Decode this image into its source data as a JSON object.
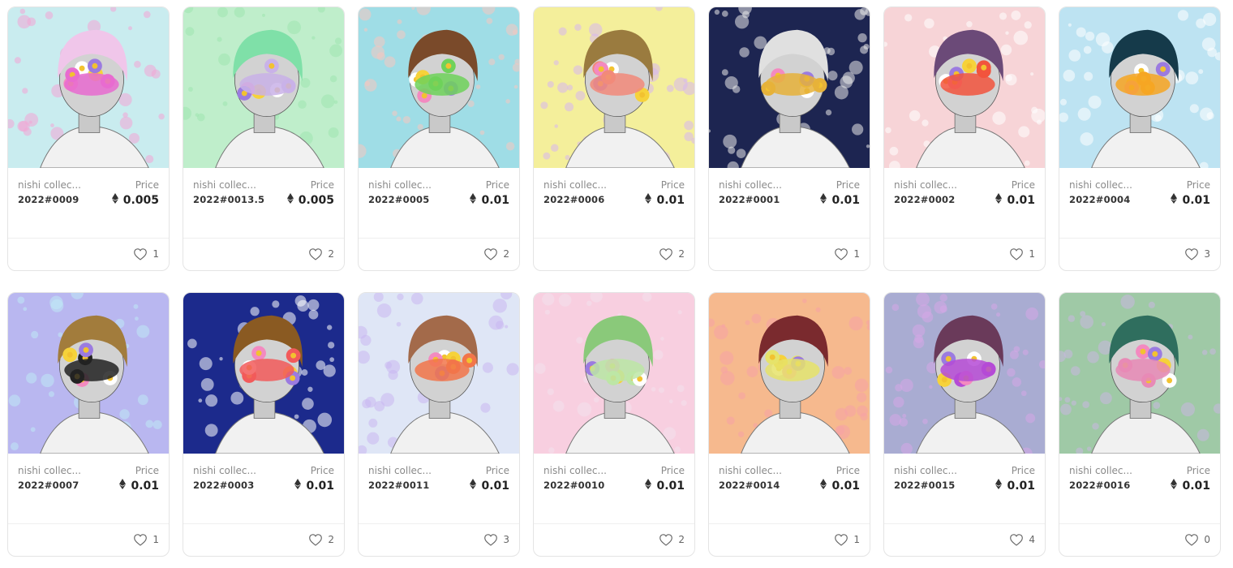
{
  "price_label": "Price",
  "cards": [
    {
      "collection": "nishi collec...",
      "name": "2022#0009",
      "price": "0.005",
      "likes": "1",
      "bg": "#c9ecef",
      "accent": "#f3a6d6",
      "hair": "#f0c6ea",
      "feature": "#e86bd0",
      "featureIcon": "flower-crown-icon"
    },
    {
      "collection": "nishi collec...",
      "name": "2022#0013.5",
      "price": "0.005",
      "likes": "2",
      "bg": "#bfeecb",
      "accent": "#9ee6b0",
      "hair": "#7fe0a8",
      "feature": "#c9b2e8",
      "featureIcon": "dino-mask-icon"
    },
    {
      "collection": "nishi collec...",
      "name": "2022#0005",
      "price": "0.01",
      "likes": "2",
      "bg": "#9fdde6",
      "accent": "#f6c7c0",
      "hair": "#7a4a2a",
      "feature": "#6fd25a",
      "featureIcon": "butterfly-mask-icon"
    },
    {
      "collection": "nishi collec...",
      "name": "2022#0006",
      "price": "0.01",
      "likes": "2",
      "bg": "#f4ef9b",
      "accent": "#d7b7f0",
      "hair": "#9a7b3f",
      "feature": "#f28a7a",
      "featureIcon": "flower-mask-icon"
    },
    {
      "collection": "nishi collec...",
      "name": "2022#0001",
      "price": "0.01",
      "likes": "1",
      "bg": "#1d2551",
      "accent": "#e9e9e9",
      "hair": "#e0e0e0",
      "feature": "#e6b23a",
      "featureIcon": "astronaut-icon"
    },
    {
      "collection": "nishi collec...",
      "name": "2022#0002",
      "price": "0.01",
      "likes": "1",
      "bg": "#f7d4d7",
      "accent": "#ffffff",
      "hair": "#6b4a78",
      "feature": "#f2543d",
      "featureIcon": "flower-crown-icon"
    },
    {
      "collection": "nishi collec...",
      "name": "2022#0004",
      "price": "0.01",
      "likes": "3",
      "bg": "#bde3f2",
      "accent": "#ffffff",
      "hair": "#153a4a",
      "feature": "#f6a623",
      "featureIcon": "flower-crown-icon"
    },
    {
      "collection": "nishi collec...",
      "name": "2022#0007",
      "price": "0.01",
      "likes": "1",
      "bg": "#b9b7f0",
      "accent": "#bfe9f6",
      "hair": "#a27c3c",
      "feature": "#222222",
      "featureIcon": "butterfly-mask-icon"
    },
    {
      "collection": "nishi collec...",
      "name": "2022#0003",
      "price": "0.01",
      "likes": "2",
      "bg": "#1c2a8c",
      "accent": "#ffffff",
      "hair": "#8a5a22",
      "feature": "#f25a5a",
      "featureIcon": "flower-mask-icon"
    },
    {
      "collection": "nishi collec...",
      "name": "2022#0011",
      "price": "0.01",
      "likes": "3",
      "bg": "#dfe6f6",
      "accent": "#c8b6f0",
      "hair": "#a36a4a",
      "feature": "#f2754a",
      "featureIcon": "deer-mask-icon"
    },
    {
      "collection": "nishi collec...",
      "name": "2022#0010",
      "price": "0.01",
      "likes": "2",
      "bg": "#f8cfe0",
      "accent": "#f3e2ec",
      "hair": "#8ac97a",
      "feature": "#bde6a6",
      "featureIcon": "bird-skull-icon"
    },
    {
      "collection": "nishi collec...",
      "name": "2022#0014",
      "price": "0.01",
      "likes": "1",
      "bg": "#f6b98e",
      "accent": "#f5a3a6",
      "hair": "#7a2a2e",
      "feature": "#e6e36a",
      "featureIcon": "beak-mask-icon"
    },
    {
      "collection": "nishi collec...",
      "name": "2022#0015",
      "price": "0.01",
      "likes": "4",
      "bg": "#a9acd2",
      "accent": "#d6a8e6",
      "hair": "#6a3a5a",
      "feature": "#b54ad6",
      "featureIcon": "crowned-dino-icon"
    },
    {
      "collection": "nishi collec...",
      "name": "2022#0016",
      "price": "0.01",
      "likes": "0",
      "bg": "#9fc9a6",
      "accent": "#c9b6e0",
      "hair": "#2f6e5e",
      "feature": "#e88ab6",
      "featureIcon": "crowned-dino-icon"
    }
  ]
}
